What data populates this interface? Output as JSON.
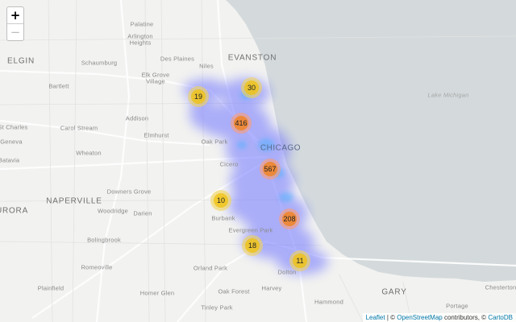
{
  "map": {
    "lake_label": "Lake Michigan",
    "places": [
      {
        "id": "palatine",
        "label": "Palatine"
      },
      {
        "id": "arlington-heights",
        "label": "Arlington"
      },
      {
        "id": "arlington-heights-2",
        "label": "Heights"
      },
      {
        "id": "elgin",
        "label": "ELGIN"
      },
      {
        "id": "schaumburg",
        "label": "Schaumburg"
      },
      {
        "id": "des-plaines",
        "label": "Des Plaines"
      },
      {
        "id": "niles",
        "label": "Niles"
      },
      {
        "id": "evanston",
        "label": "EVANSTON"
      },
      {
        "id": "bartlett",
        "label": "Bartlett"
      },
      {
        "id": "elk-grove",
        "label": "Elk Grove"
      },
      {
        "id": "elk-grove-2",
        "label": "Village"
      },
      {
        "id": "addison",
        "label": "Addison"
      },
      {
        "id": "st-charles",
        "label": "St Charles"
      },
      {
        "id": "carol-stream",
        "label": "Carol Stream"
      },
      {
        "id": "elmhurst",
        "label": "Elmhurst"
      },
      {
        "id": "oak-park",
        "label": "Oak Park"
      },
      {
        "id": "chicago",
        "label": "CHICAGO"
      },
      {
        "id": "geneva",
        "label": "Geneva"
      },
      {
        "id": "wheaton",
        "label": "Wheaton"
      },
      {
        "id": "batavia",
        "label": "Batavia"
      },
      {
        "id": "cicero",
        "label": "Cicero"
      },
      {
        "id": "downers-grove",
        "label": "Downers Grove"
      },
      {
        "id": "naperville",
        "label": "NAPERVILLE"
      },
      {
        "id": "aurora",
        "label": "URORA"
      },
      {
        "id": "woodridge",
        "label": "Woodridge"
      },
      {
        "id": "darien",
        "label": "Darien"
      },
      {
        "id": "burbank",
        "label": "Burbank"
      },
      {
        "id": "evergreen-park",
        "label": "Evergreen Park"
      },
      {
        "id": "bolingbrook",
        "label": "Bolingbrook"
      },
      {
        "id": "romeoville",
        "label": "Romeoville"
      },
      {
        "id": "orland-park",
        "label": "Orland Park"
      },
      {
        "id": "dolton",
        "label": "Dolton"
      },
      {
        "id": "plainfield",
        "label": "Plainfield"
      },
      {
        "id": "homer-glen",
        "label": "Homer Glen"
      },
      {
        "id": "oak-forest",
        "label": "Oak Forest"
      },
      {
        "id": "harvey",
        "label": "Harvey"
      },
      {
        "id": "gary",
        "label": "GARY"
      },
      {
        "id": "chesterton",
        "label": "Chesterton"
      },
      {
        "id": "hammond",
        "label": "Hammond"
      },
      {
        "id": "tinley-park",
        "label": "Tinley Park"
      },
      {
        "id": "portage",
        "label": "Portage"
      }
    ],
    "clusters": [
      {
        "id": "c30",
        "count": "30",
        "size": "small"
      },
      {
        "id": "c19",
        "count": "19",
        "size": "small"
      },
      {
        "id": "c416",
        "count": "416",
        "size": "large"
      },
      {
        "id": "c567",
        "count": "567",
        "size": "large"
      },
      {
        "id": "c10",
        "count": "10",
        "size": "small"
      },
      {
        "id": "c208",
        "count": "208",
        "size": "large"
      },
      {
        "id": "c18",
        "count": "18",
        "size": "small"
      },
      {
        "id": "c11",
        "count": "11",
        "size": "small"
      }
    ],
    "colors": {
      "land": "#f2f2f0",
      "water": "#d4dadc",
      "heat": "#6f74ff",
      "heat_hot": "#3fb2ff",
      "cluster_small": "#f0c20c",
      "cluster_large": "#f18017"
    }
  },
  "zoom": {
    "in_label": "+",
    "out_label": "−"
  },
  "attribution": {
    "leaflet_link": "Leaflet",
    "separator": " | © ",
    "osm_link": "OpenStreetMap",
    "contributors_text": " contributors, © ",
    "carto_link": "CartoDB"
  }
}
